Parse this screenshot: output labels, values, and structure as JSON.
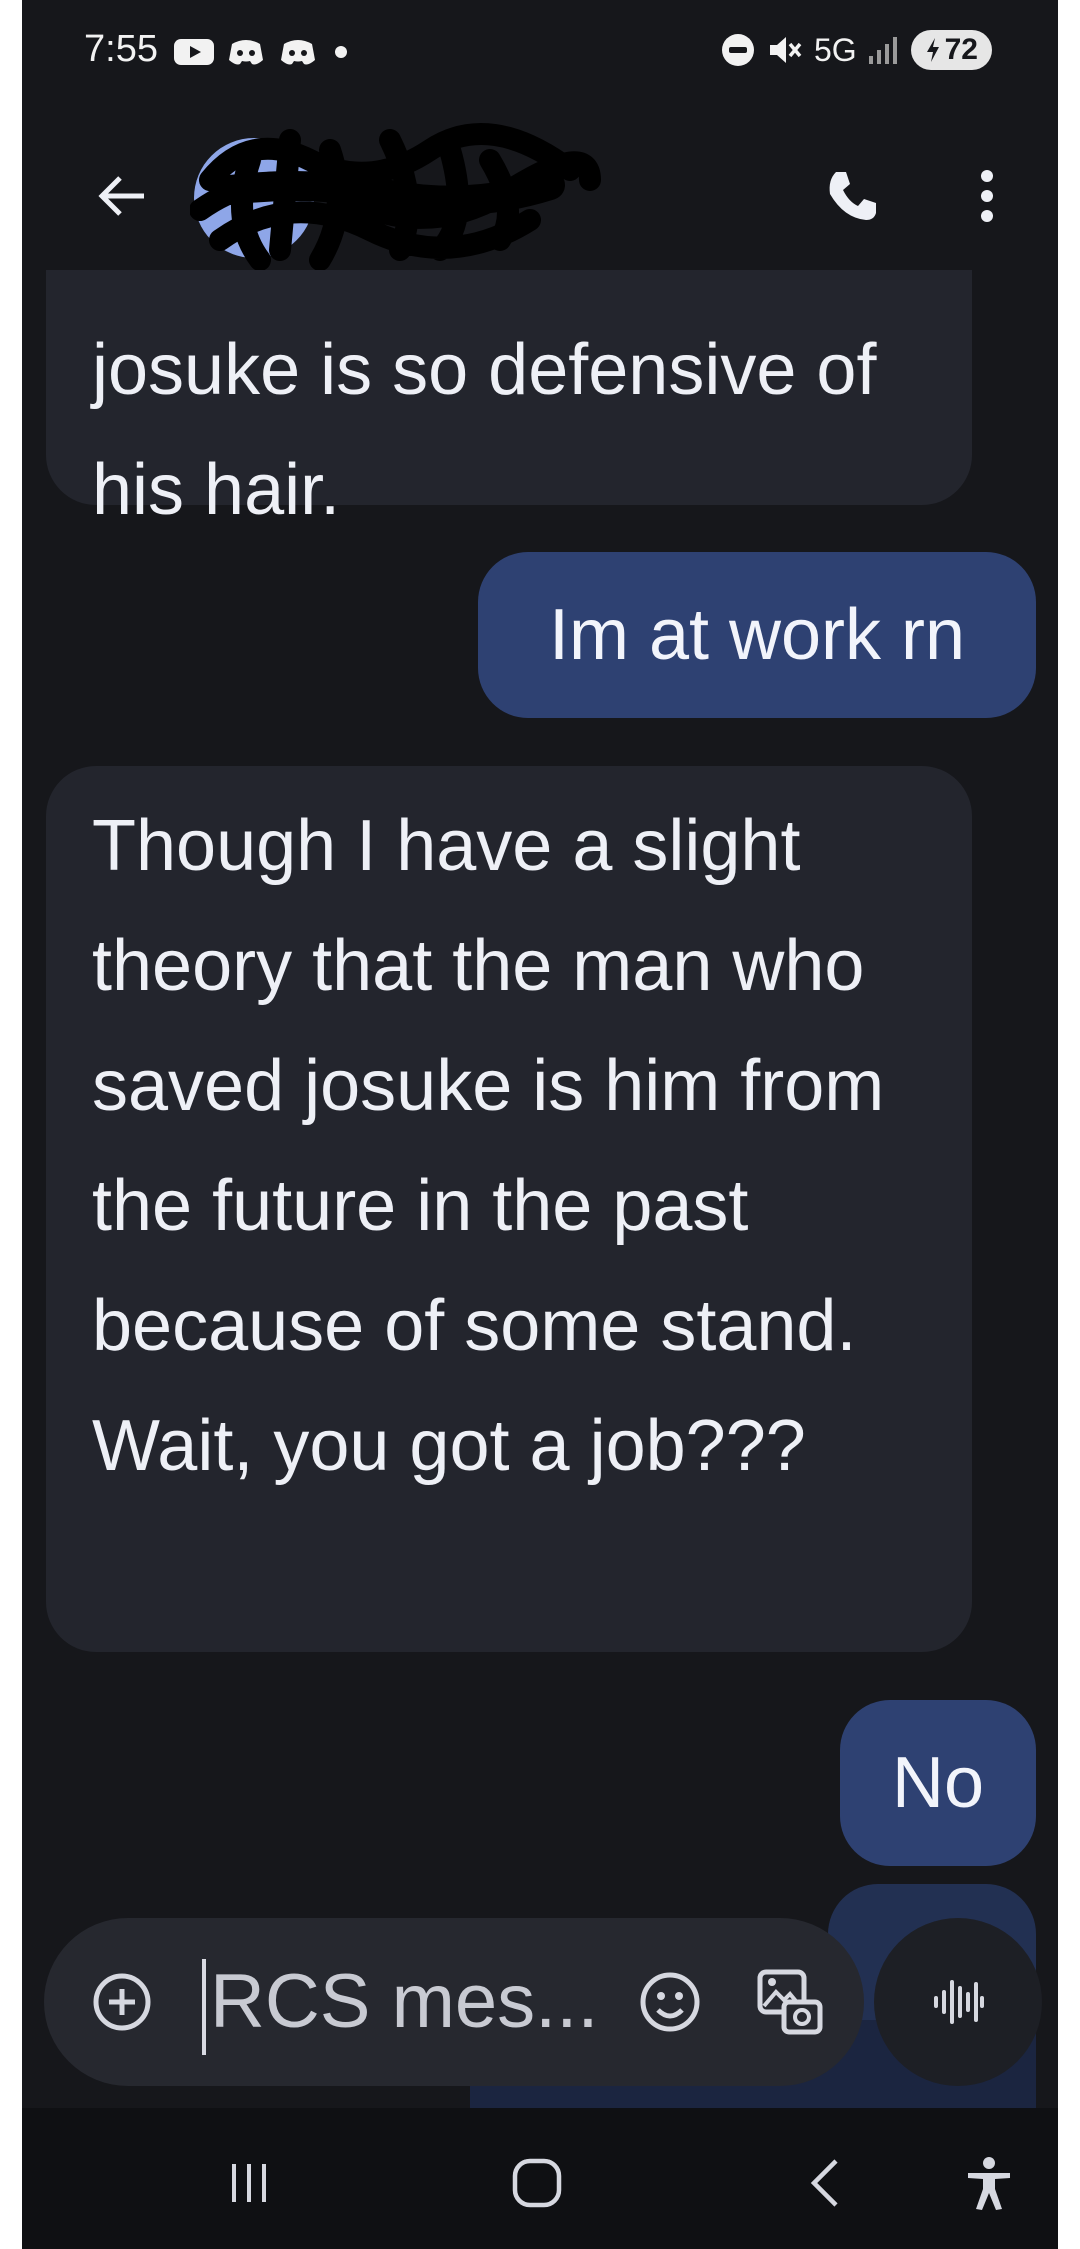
{
  "status_bar": {
    "time": "7:55",
    "app_icons": [
      "youtube-icon",
      "discord-icon",
      "discord-icon"
    ],
    "network": "5G",
    "battery": "72"
  },
  "header": {
    "contact_name": "",
    "icons": {
      "back": "arrow-back-icon",
      "call": "phone-icon",
      "more": "more-vert-icon"
    }
  },
  "messages": [
    {
      "type": "received",
      "text": "josuke is so defensive of his hair."
    },
    {
      "type": "sent",
      "text": "Im at work rn"
    },
    {
      "type": "received",
      "text": "Though I have a slight theory that the man who saved josuke is him from the future in the past because of some stand. Wait, you got a job???"
    },
    {
      "type": "sent",
      "text": "No"
    }
  ],
  "composer": {
    "placeholder": "RCS mes...",
    "icons": {
      "attach": "add-circle-icon",
      "emoji": "emoji-icon",
      "gallery": "gallery-icon",
      "voice": "voice-waveform-icon"
    }
  },
  "nav": {
    "icons": [
      "recents-icon",
      "home-icon",
      "back-icon",
      "accessibility-icon"
    ]
  },
  "colors": {
    "background": "#16171b",
    "received_bubble": "#23252d",
    "sent_bubble": "#2e4172",
    "text": "#eef0f6"
  }
}
